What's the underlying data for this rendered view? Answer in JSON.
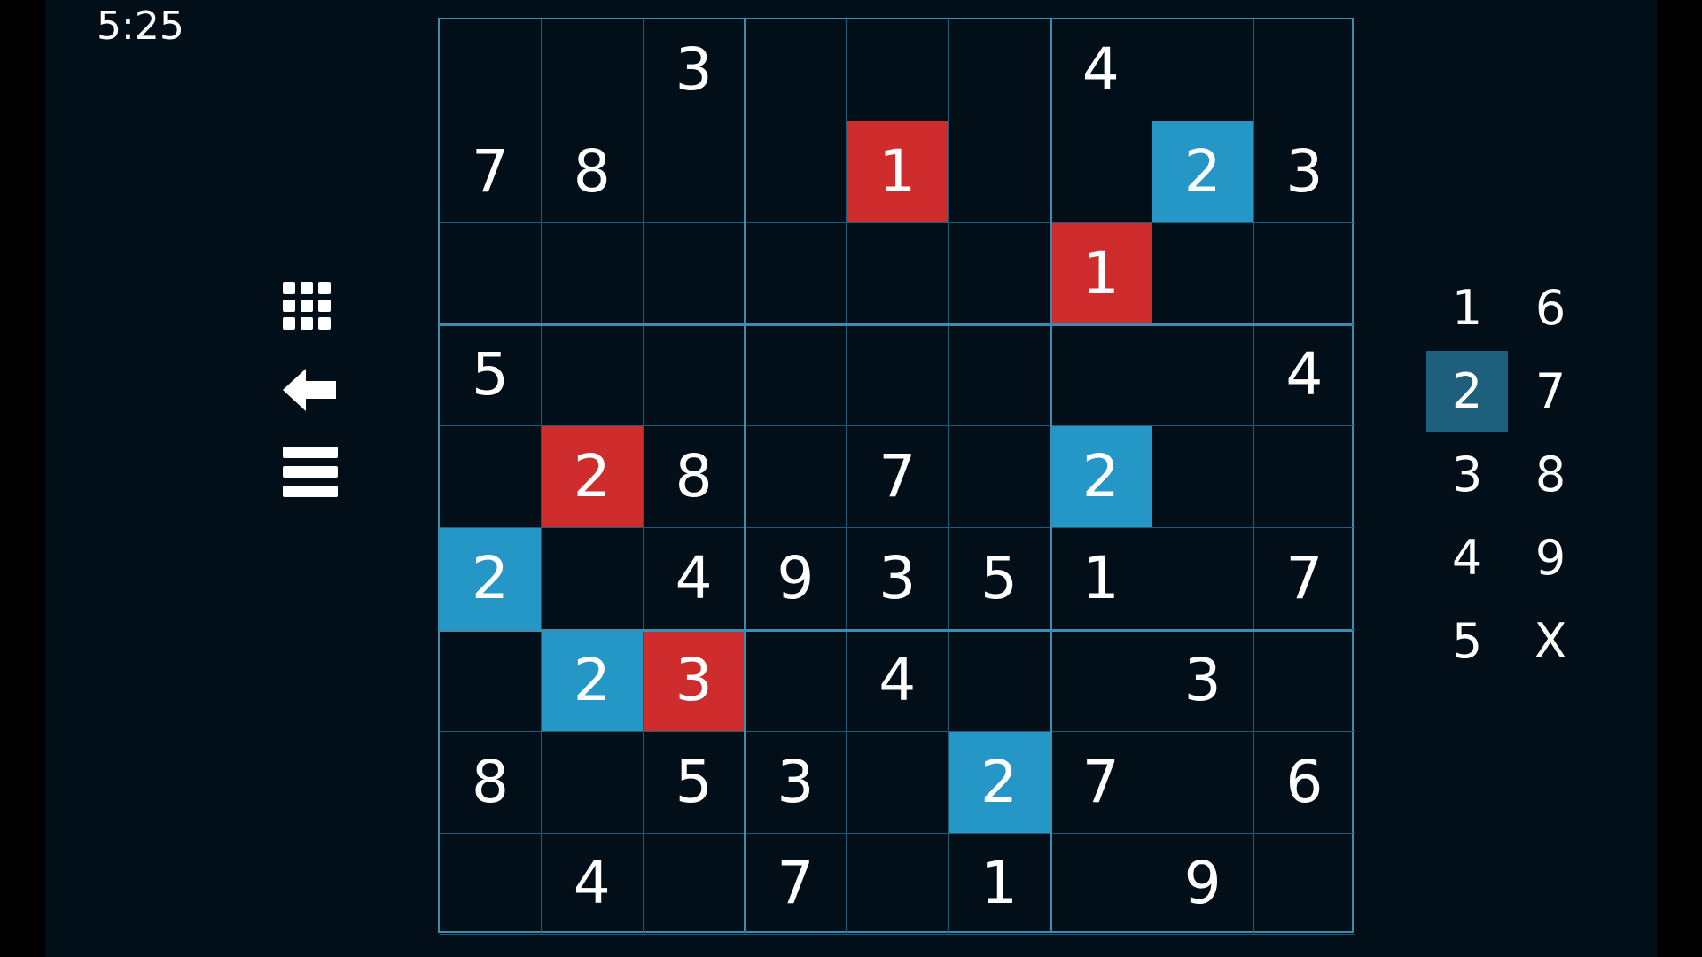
{
  "timer": "5:25",
  "colors": {
    "background": "#030f18",
    "grid": "#3b8eb0",
    "conflict_red": "#cf2d2d",
    "highlight_blue": "#2597c7",
    "selected_key": "#1e5f7d"
  },
  "icons": [
    "grid-icon",
    "back-arrow-icon",
    "menu-icon"
  ],
  "board": [
    [
      "",
      "",
      "3",
      "",
      "",
      "",
      "4",
      "",
      ""
    ],
    [
      "7",
      "8",
      "",
      "",
      "1",
      "",
      "",
      "2",
      "3"
    ],
    [
      "",
      "",
      "",
      "",
      "",
      "",
      "1",
      "",
      ""
    ],
    [
      "5",
      "",
      "",
      "",
      "",
      "",
      "",
      "",
      "4"
    ],
    [
      "",
      "2",
      "8",
      "",
      "7",
      "",
      "2",
      "",
      ""
    ],
    [
      "2",
      "",
      "4",
      "9",
      "3",
      "5",
      "1",
      "",
      "7"
    ],
    [
      "",
      "2",
      "3",
      "",
      "4",
      "",
      "",
      "3",
      ""
    ],
    [
      "8",
      "",
      "5",
      "3",
      "",
      "2",
      "7",
      "",
      "6"
    ],
    [
      "",
      "4",
      "",
      "7",
      "",
      "1",
      "",
      "9",
      ""
    ]
  ],
  "cell_states": [
    [
      "",
      "",
      "",
      "",
      "",
      "",
      "",
      "",
      ""
    ],
    [
      "",
      "",
      "",
      "",
      "red",
      "",
      "",
      "blue",
      ""
    ],
    [
      "",
      "",
      "",
      "",
      "",
      "",
      "red",
      "",
      ""
    ],
    [
      "",
      "",
      "",
      "",
      "",
      "",
      "",
      "",
      ""
    ],
    [
      "",
      "red",
      "",
      "",
      "",
      "",
      "blue",
      "",
      ""
    ],
    [
      "blue",
      "",
      "",
      "",
      "",
      "",
      "",
      "",
      ""
    ],
    [
      "",
      "blue",
      "red",
      "",
      "",
      "",
      "",
      "",
      ""
    ],
    [
      "",
      "",
      "",
      "",
      "",
      "blue",
      "",
      "",
      ""
    ],
    [
      "",
      "",
      "",
      "",
      "",
      "",
      "",
      "",
      ""
    ]
  ],
  "number_pad": {
    "keys": [
      "1",
      "2",
      "3",
      "4",
      "5",
      "6",
      "7",
      "8",
      "9",
      "X"
    ],
    "selected": "2"
  }
}
